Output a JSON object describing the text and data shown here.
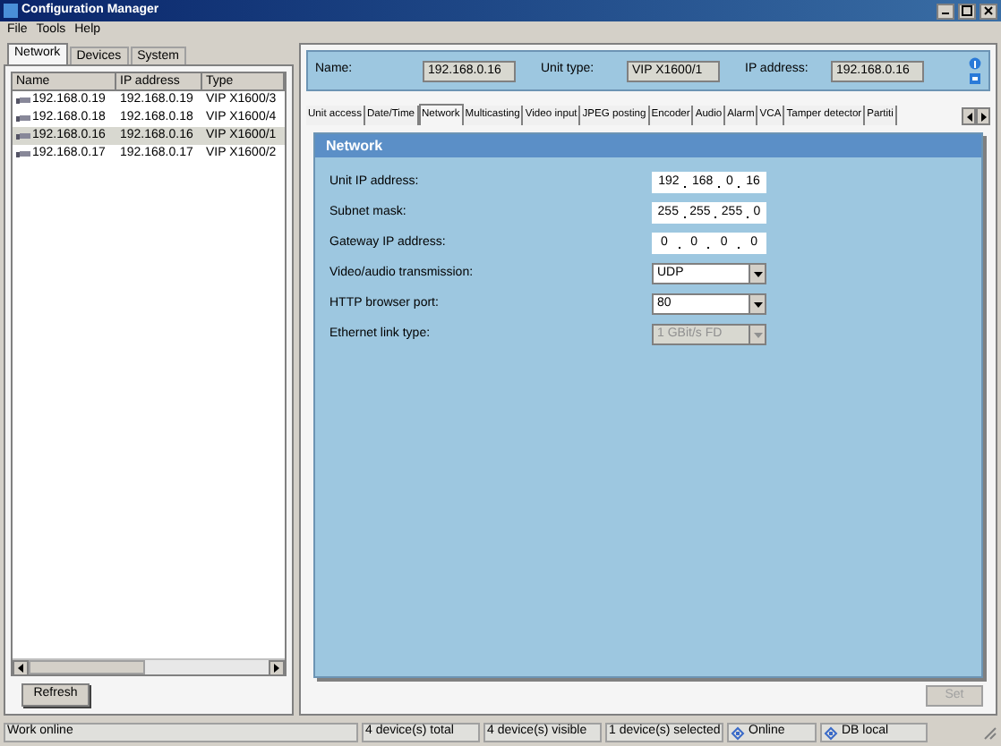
{
  "window": {
    "title": "Configuration Manager"
  },
  "menu": [
    "File",
    "Tools",
    "Help"
  ],
  "left_tabs": [
    {
      "label": "Network",
      "selected": true
    },
    {
      "label": "Devices",
      "selected": false
    },
    {
      "label": "System",
      "selected": false
    }
  ],
  "device_table": {
    "columns": [
      "Name",
      "IP address",
      "Type"
    ],
    "rows": [
      {
        "cells": [
          "192.168.0.19",
          "192.168.0.19",
          "VIP X1600/3"
        ],
        "selected": false
      },
      {
        "cells": [
          "192.168.0.18",
          "192.168.0.18",
          "VIP X1600/4"
        ],
        "selected": false
      },
      {
        "cells": [
          "192.168.0.16",
          "192.168.0.16",
          "VIP X1600/1"
        ],
        "selected": true
      },
      {
        "cells": [
          "192.168.0.17",
          "192.168.0.17",
          "VIP X1600/2"
        ],
        "selected": false
      }
    ]
  },
  "refresh_button": "Refresh",
  "info_bar": [
    {
      "label": "Name:",
      "value": "192.168.0.16"
    },
    {
      "label": "Unit type:",
      "value": "VIP X1600/1"
    },
    {
      "label": "IP address:",
      "value": "192.168.0.16"
    }
  ],
  "tabs": [
    {
      "label": "Unit access",
      "selected": false
    },
    {
      "label": "Date/Time",
      "selected": false
    },
    {
      "label": "Network",
      "selected": true
    },
    {
      "label": "Multicasting",
      "selected": false
    },
    {
      "label": "Video input",
      "selected": false
    },
    {
      "label": "JPEG posting",
      "selected": false
    },
    {
      "label": "Encoder",
      "selected": false
    },
    {
      "label": "Audio",
      "selected": false
    },
    {
      "label": "Alarm",
      "selected": false
    },
    {
      "label": "VCA",
      "selected": false
    },
    {
      "label": "Tamper detector",
      "selected": false
    },
    {
      "label": "Partiti",
      "selected": false
    }
  ],
  "panel": {
    "title": "Network",
    "fields": [
      {
        "kind": "ip",
        "label": "Unit IP address:",
        "octets": [
          "192",
          "168",
          "0",
          "16"
        ]
      },
      {
        "kind": "ip",
        "label": "Subnet mask:",
        "octets": [
          "255",
          "255",
          "255",
          "0"
        ]
      },
      {
        "kind": "ip",
        "label": "Gateway IP address:",
        "octets": [
          "0",
          "0",
          "0",
          "0"
        ]
      },
      {
        "kind": "select",
        "label": "Video/audio transmission:",
        "value": "UDP",
        "disabled": false
      },
      {
        "kind": "select",
        "label": "HTTP browser port:",
        "value": "80",
        "disabled": false
      },
      {
        "kind": "select",
        "label": "Ethernet link type:",
        "value": "1 GBit/s FD",
        "disabled": true
      }
    ]
  },
  "set_button": {
    "label": "Set",
    "disabled": true
  },
  "status_bar": [
    {
      "kind": "text",
      "text": "Work online"
    },
    {
      "kind": "text",
      "text": "4 device(s) total"
    },
    {
      "kind": "text",
      "text": "4 device(s) visible"
    },
    {
      "kind": "text",
      "text": "1 device(s) selected"
    },
    {
      "kind": "icon",
      "text": "Online"
    },
    {
      "kind": "icon",
      "text": "DB local"
    }
  ]
}
